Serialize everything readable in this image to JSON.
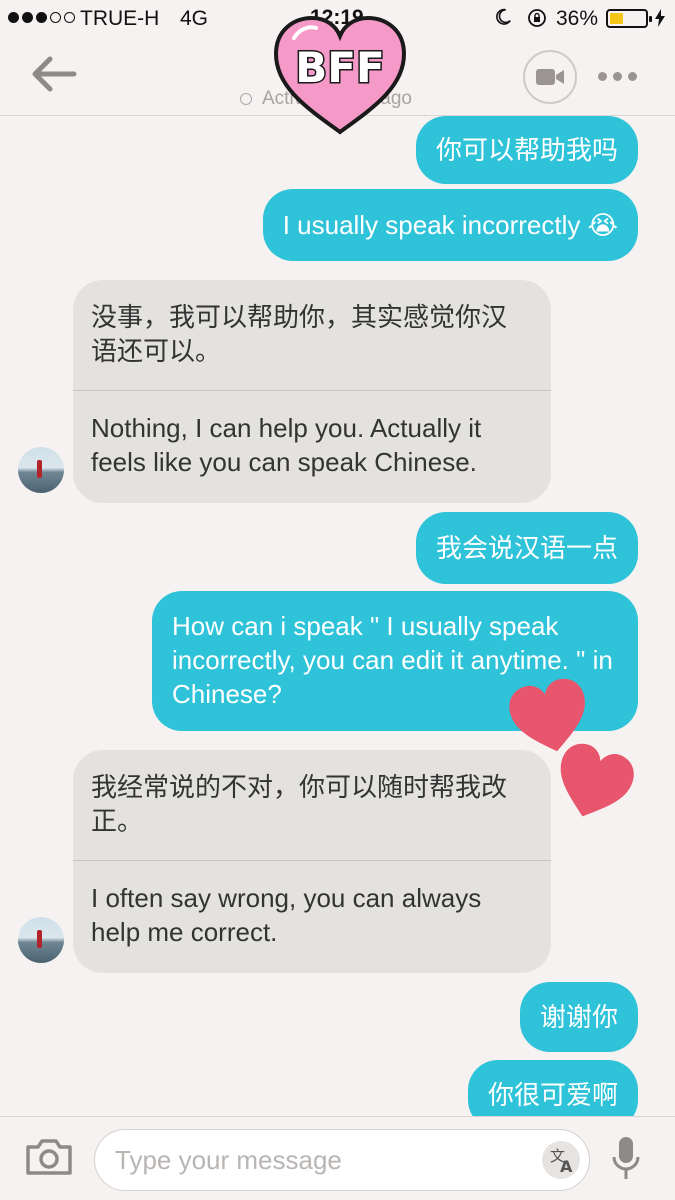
{
  "status_bar": {
    "carrier": "TRUE-H",
    "network": "4G",
    "time": "12:19",
    "battery_percent": "36%",
    "battery_level": 0.36
  },
  "header": {
    "presence": "Active 5 mins ago",
    "sticker_text": "BFF"
  },
  "messages": {
    "out_1": "你可以帮助我吗",
    "out_2": "I usually speak incorrectly 😭",
    "in_1_original": "没事，我可以帮助你，其实感觉你汉语还可以。",
    "in_1_translation": "Nothing, I can help you. Actually it feels like you can speak Chinese.",
    "out_3": "我会说汉语一点",
    "out_4": "How can i speak \" I usually speak incorrectly, you can edit it anytime. \" in Chinese?",
    "in_2_original": "我经常说的不对，你可以随时帮我改正。",
    "in_2_translation": "I often say wrong, you can always help me correct.",
    "out_5": "谢谢你",
    "out_6": "你很可爱啊"
  },
  "composer": {
    "placeholder": "Type your message"
  },
  "colors": {
    "outgoing_bubble": "#2ec3d8",
    "incoming_bubble": "#e4e2df",
    "heart": "#e8566d",
    "background": "#f6f2f1"
  },
  "icons": [
    "back-arrow-icon",
    "video-camera-icon",
    "more-dots-icon",
    "camera-icon",
    "translate-icon",
    "microphone-icon",
    "heart-sticker-icon",
    "moon-icon",
    "rotation-lock-icon",
    "charging-bolt-icon"
  ]
}
